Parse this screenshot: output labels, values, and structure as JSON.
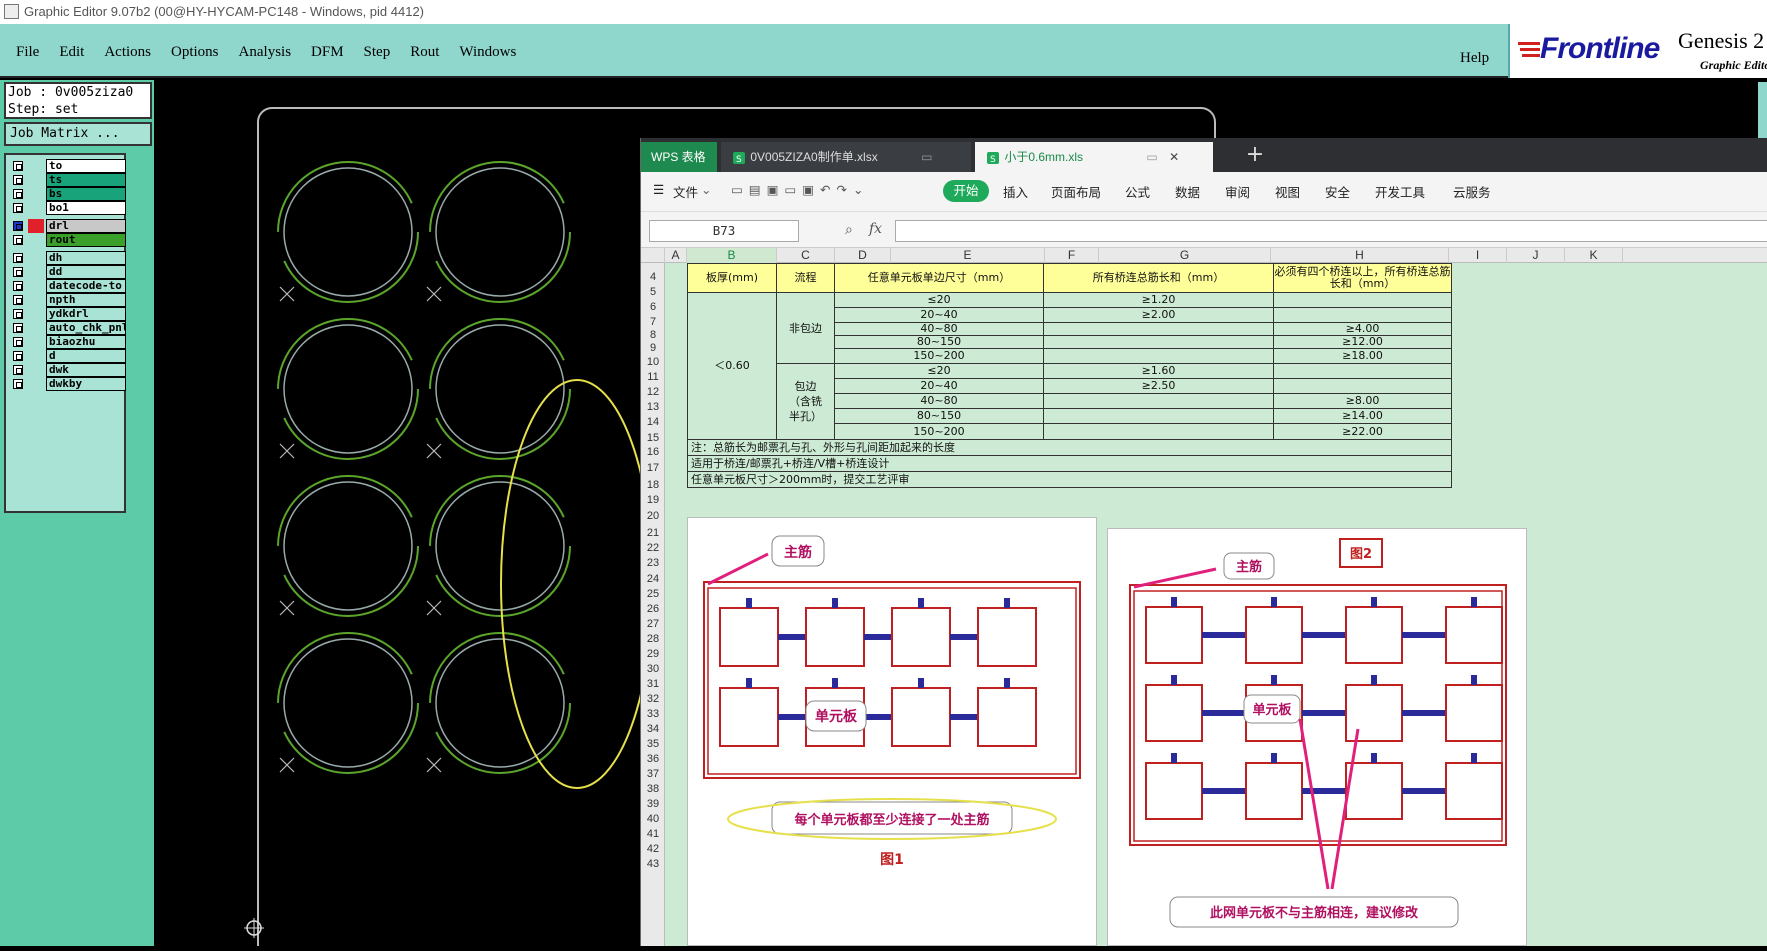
{
  "window": {
    "title": "Graphic Editor 9.07b2 (00@HY-HYCAM-PC148 - Windows, pid 4412)"
  },
  "menubar": {
    "items": [
      "File",
      "Edit",
      "Actions",
      "Options",
      "Analysis",
      "DFM",
      "Step",
      "Rout",
      "Windows"
    ],
    "help": "Help"
  },
  "logo": {
    "brand": "Frontline",
    "product": "Genesis 2",
    "subtitle": "Graphic Editor"
  },
  "job": {
    "job_line": "Job : 0v005ziza0",
    "step_line": "Step: set",
    "matrix_button": "Job Matrix ..."
  },
  "layers": [
    {
      "name": "to",
      "color": "#ffffff"
    },
    {
      "name": "ts",
      "color": "#19a37a"
    },
    {
      "name": "bs",
      "color": "#19a37a"
    },
    {
      "name": "bo1",
      "color": "#ffffff"
    },
    {
      "name": "drl",
      "color": "#e0202a",
      "active": true
    },
    {
      "name": "rout",
      "color": "#3aa02a"
    },
    {
      "name": "dh",
      "color": "#a9e3d5"
    },
    {
      "name": "dd",
      "color": "#a9e3d5"
    },
    {
      "name": "datecode-to",
      "color": "#a9e3d5"
    },
    {
      "name": "npth",
      "color": "#a9e3d5"
    },
    {
      "name": "ydkdrl",
      "color": "#a9e3d5"
    },
    {
      "name": "auto_chk_pnl",
      "color": "#a9e3d5"
    },
    {
      "name": "biaozhu",
      "color": "#a9e3d5"
    },
    {
      "name": "d",
      "color": "#a9e3d5"
    },
    {
      "name": "dwk",
      "color": "#a9e3d5"
    },
    {
      "name": "dwkby",
      "color": "#a9e3d5"
    }
  ],
  "wps": {
    "app_tab": "WPS 表格",
    "file_tabs": [
      "0V005ZIZA0制作单.xlsx",
      "小于0.6mm.xls"
    ],
    "ribbon": {
      "file": "文件",
      "start": "开始",
      "items": [
        "插入",
        "页面布局",
        "公式",
        "数据",
        "审阅",
        "视图",
        "安全",
        "开发工具",
        "云服务"
      ]
    },
    "namebox": "B73",
    "fx": "fx",
    "columns": [
      "A",
      "B",
      "C",
      "D",
      "E",
      "F",
      "G",
      "H",
      "I",
      "J",
      "K"
    ],
    "rows": [
      "4",
      "5",
      "6",
      "7",
      "8",
      "9",
      "10",
      "11",
      "12",
      "13",
      "14",
      "15",
      "16",
      "17",
      "18",
      "19",
      "20",
      "21",
      "22",
      "23",
      "24",
      "25",
      "26",
      "27",
      "28",
      "29",
      "30",
      "31",
      "32",
      "33",
      "34",
      "35",
      "36",
      "37",
      "38",
      "39",
      "40",
      "41",
      "42",
      "43"
    ],
    "table": {
      "headers": [
        "板厚(mm)",
        "流程",
        "任意单元板单边尺寸（mm）",
        "所有桥连总筋长和（mm）",
        "必须有四个桥连以上，所有桥连总筋长和（mm）"
      ],
      "thickness": "＜0.60",
      "groups": [
        {
          "process": "非包边",
          "rows": [
            {
              "size": "≤20",
              "g": "≥1.20",
              "h": ""
            },
            {
              "size": "20~40",
              "g": "≥2.00",
              "h": ""
            },
            {
              "size": "40~80",
              "g": "",
              "h": "≥4.00"
            },
            {
              "size": "80~150",
              "g": "",
              "h": "≥12.00"
            },
            {
              "size": "150~200",
              "g": "",
              "h": "≥18.00"
            }
          ]
        },
        {
          "process": "包边（含铣半孔）",
          "rows": [
            {
              "size": "≤20",
              "g": "≥1.60",
              "h": ""
            },
            {
              "size": "20~40",
              "g": "≥2.50",
              "h": ""
            },
            {
              "size": "40~80",
              "g": "",
              "h": "≥8.00"
            },
            {
              "size": "80~150",
              "g": "",
              "h": "≥14.00"
            },
            {
              "size": "150~200",
              "g": "",
              "h": "≥22.00"
            }
          ]
        }
      ],
      "notes": [
        "注：总筋长为邮票孔与孔、外形与孔间距加起来的长度",
        "适用于桥连/邮票孔+桥连/V槽+桥连设计",
        "任意单元板尺寸＞200mm时，提交工艺评审"
      ]
    },
    "figure1": {
      "main_label": "主筋",
      "unit_label": "单元板",
      "caption": "每个单元板都至少连接了一处主筋",
      "fig_label": "图1"
    },
    "figure2": {
      "fig_label": "图2",
      "main_label": "主筋",
      "unit_label": "单元板",
      "caption": "此网单元板不与主筋相连，建议修改"
    }
  },
  "colors": {
    "menubar": "#8fd6cd",
    "panel": "#5dcaa8",
    "rout": "#5aa52a",
    "highlight": "#e6e04a",
    "wps_green": "#1faa5b"
  }
}
